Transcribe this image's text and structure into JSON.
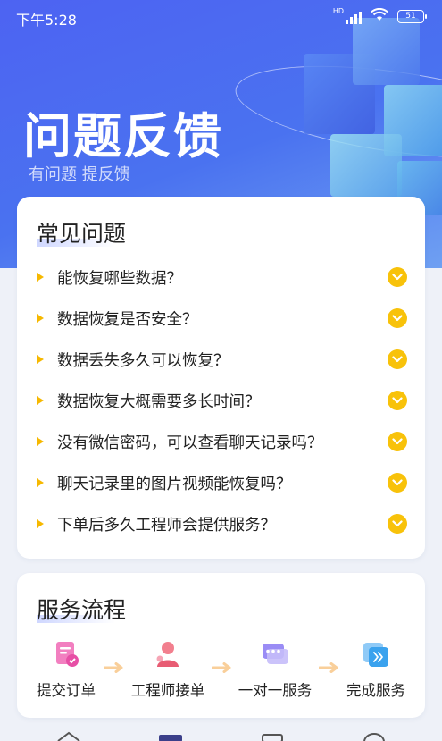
{
  "status_bar": {
    "time": "下午5:28",
    "network": "HD",
    "battery": "51"
  },
  "hero": {
    "title": "问题反馈",
    "subtitle": "有问题 提反馈"
  },
  "faq": {
    "title": "常见问题",
    "items": [
      "能恢复哪些数据？",
      "数据恢复是否安全？",
      "数据丢失多久可以恢复？",
      "数据恢复大概需要多长时间？",
      "没有微信密码，可以查看聊天记录吗？",
      "聊天记录里的图片视频能恢复吗？",
      "下单后多久工程师会提供服务？"
    ]
  },
  "flow": {
    "title": "服务流程",
    "steps": [
      "提交订单",
      "工程师接单",
      "一对一服务",
      "完成服务"
    ]
  },
  "colors": {
    "hero": "#4d63f2",
    "accent_yellow": "#f8c20a",
    "card_bg": "#ffffff",
    "page_bg": "#eef1f8"
  },
  "icons": {
    "faq_bullet": "triangle-right-icon",
    "faq_expand": "chevron-down-icon",
    "flow_steps": [
      "order-document-icon",
      "engineer-icon",
      "chat-bubble-icon",
      "done-forward-icon"
    ],
    "bottom_nav": [
      "home-icon",
      "service-icon",
      "order-icon",
      "profile-icon"
    ]
  }
}
